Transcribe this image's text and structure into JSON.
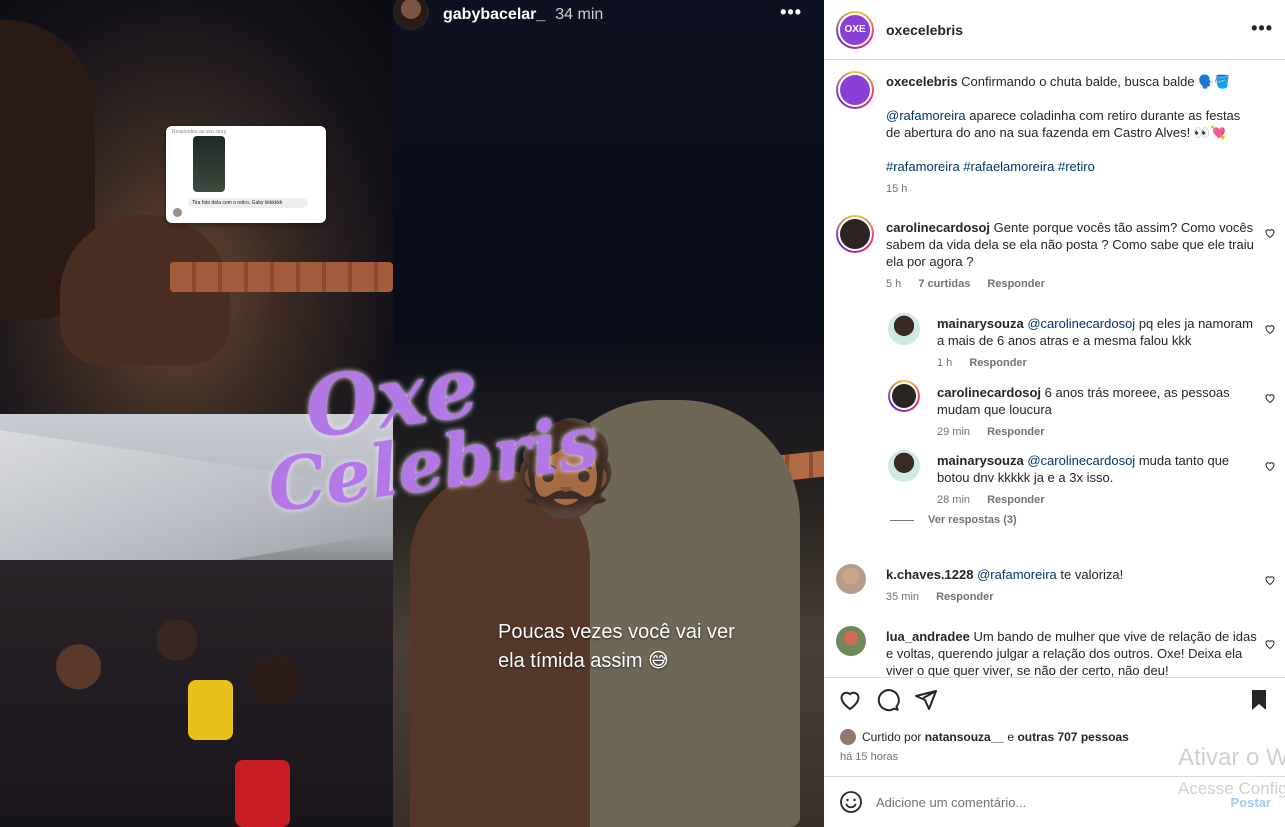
{
  "story": {
    "username": "gabybacelar_",
    "time": "34 min",
    "more": "•••",
    "caption_line1": "Poucas vezes você vai ver",
    "caption_line2": "ela tímida assim 😅",
    "watermark_line1": "Oxe",
    "watermark_line2": "Celebris",
    "face_emoji": "🧔🏾",
    "dm_top": "Respondeu ao seu story",
    "dm_message": "Tira foto dela com o retiro, Gaby kkkkkkk"
  },
  "post": {
    "author": "oxecelebris",
    "brand_short": "OXE",
    "brand_sub": "Celebris",
    "more": "•••",
    "caption": {
      "username": "oxecelebris",
      "text": "Confirmando o chuta balde, busca balde 🗣️🪣",
      "mention": "@rafamoreira",
      "text2": "aparece coladinha com retiro durante as festas de abertura do ano na sua fazenda em Castro Alves! 👀💘",
      "hashtags": "#rafamoreira #rafaelamoreira #retiro",
      "time": "15 h"
    },
    "comments": [
      {
        "username": "carolinecardosoj",
        "text": "Gente porque vocês tão assim? Como vocês sabem da vida dela se ela não posta ? Como sabe que ele traiu ela por agora ?",
        "time": "5 h",
        "likes": "7 curtidas",
        "reply": "Responder"
      },
      {
        "username": "k.chaves.1228",
        "mention": "@rafamoreira",
        "text": "te valoriza!",
        "time": "35 min",
        "reply": "Responder"
      },
      {
        "username": "lua_andradee",
        "text": "Um bando de mulher que vive de relação de idas e voltas, querendo julgar a relação dos outros. Oxe! Deixa ela viver o que quer viver, se não der certo, não deu!"
      }
    ],
    "replies": [
      {
        "username": "mainarysouza",
        "mention": "@carolinecardosoj",
        "text": "pq eles ja namoram a mais de 6 anos atras e a mesma falou kkk",
        "time": "1 h",
        "reply": "Responder"
      },
      {
        "username": "carolinecardosoj",
        "text": "6 anos trás moreee, as pessoas mudam que loucura",
        "time": "29 min",
        "reply": "Responder"
      },
      {
        "username": "mainarysouza",
        "mention": "@carolinecardosoj",
        "text": "muda tanto que botou dnv kkkkk ja e a 3x isso.",
        "time": "28 min",
        "reply": "Responder"
      }
    ],
    "view_replies": "Ver respostas (3)",
    "liked_by_prefix": "Curtido por",
    "liked_by_user": "natansouza__",
    "liked_by_and": "e",
    "liked_by_others": "outras 707 pessoas",
    "date": "há 15 horas",
    "comment_placeholder": "Adicione um comentário...",
    "post_button": "Postar"
  },
  "overlay": {
    "activate_title": "Ativar o Windows",
    "activate_sub": "Acesse Configurações"
  },
  "colors": {
    "link": "#00376b",
    "muted": "#737373",
    "post_button": "#9fcdf6",
    "watermark": "#b478e6"
  }
}
